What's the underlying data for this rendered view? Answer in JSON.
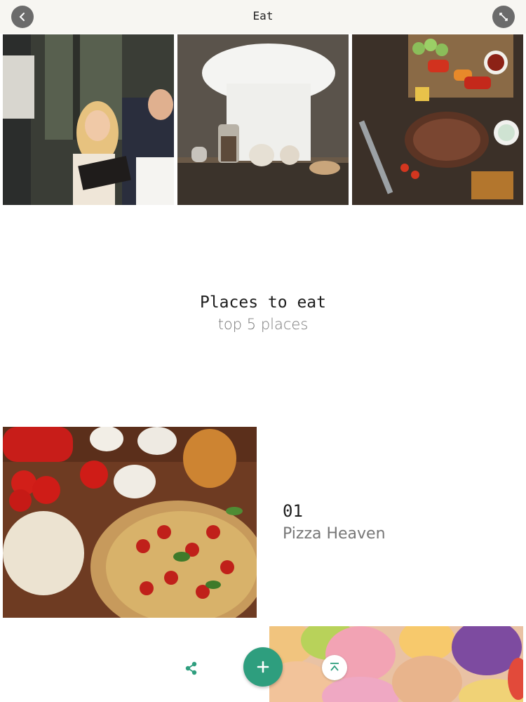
{
  "header": {
    "title": "Eat",
    "back_icon": "chevron-left-icon",
    "expand_icon": "expand-icon"
  },
  "gallery": {
    "images": [
      {
        "name": "restaurant-couple-photo"
      },
      {
        "name": "chef-hat-photo"
      },
      {
        "name": "grilled-steak-vegetables-photo"
      }
    ]
  },
  "section": {
    "title": "Places to eat",
    "subtitle": "top 5 places"
  },
  "items": [
    {
      "number": "01",
      "name": "Pizza Heaven",
      "image": "pizza-photo"
    }
  ],
  "next_image": "macarons-photo",
  "toolbar": {
    "share_icon": "share-icon",
    "add_icon": "plus-icon",
    "top_icon": "scroll-to-top-icon",
    "accent": "#2e9e7e"
  }
}
